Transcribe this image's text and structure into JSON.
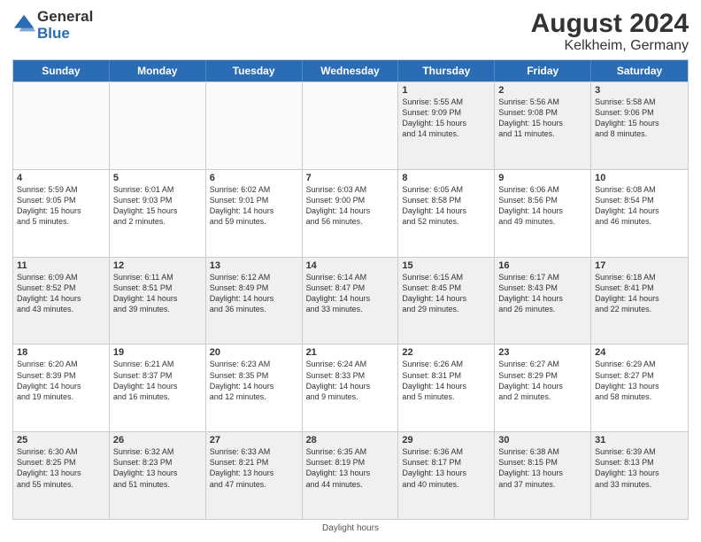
{
  "header": {
    "logo_general": "General",
    "logo_blue": "Blue",
    "main_title": "August 2024",
    "subtitle": "Kelkheim, Germany"
  },
  "days_of_week": [
    "Sunday",
    "Monday",
    "Tuesday",
    "Wednesday",
    "Thursday",
    "Friday",
    "Saturday"
  ],
  "footer": "Daylight hours",
  "weeks": [
    [
      {
        "day": "",
        "info": ""
      },
      {
        "day": "",
        "info": ""
      },
      {
        "day": "",
        "info": ""
      },
      {
        "day": "",
        "info": ""
      },
      {
        "day": "1",
        "info": "Sunrise: 5:55 AM\nSunset: 9:09 PM\nDaylight: 15 hours\nand 14 minutes."
      },
      {
        "day": "2",
        "info": "Sunrise: 5:56 AM\nSunset: 9:08 PM\nDaylight: 15 hours\nand 11 minutes."
      },
      {
        "day": "3",
        "info": "Sunrise: 5:58 AM\nSunset: 9:06 PM\nDaylight: 15 hours\nand 8 minutes."
      }
    ],
    [
      {
        "day": "4",
        "info": "Sunrise: 5:59 AM\nSunset: 9:05 PM\nDaylight: 15 hours\nand 5 minutes."
      },
      {
        "day": "5",
        "info": "Sunrise: 6:01 AM\nSunset: 9:03 PM\nDaylight: 15 hours\nand 2 minutes."
      },
      {
        "day": "6",
        "info": "Sunrise: 6:02 AM\nSunset: 9:01 PM\nDaylight: 14 hours\nand 59 minutes."
      },
      {
        "day": "7",
        "info": "Sunrise: 6:03 AM\nSunset: 9:00 PM\nDaylight: 14 hours\nand 56 minutes."
      },
      {
        "day": "8",
        "info": "Sunrise: 6:05 AM\nSunset: 8:58 PM\nDaylight: 14 hours\nand 52 minutes."
      },
      {
        "day": "9",
        "info": "Sunrise: 6:06 AM\nSunset: 8:56 PM\nDaylight: 14 hours\nand 49 minutes."
      },
      {
        "day": "10",
        "info": "Sunrise: 6:08 AM\nSunset: 8:54 PM\nDaylight: 14 hours\nand 46 minutes."
      }
    ],
    [
      {
        "day": "11",
        "info": "Sunrise: 6:09 AM\nSunset: 8:52 PM\nDaylight: 14 hours\nand 43 minutes."
      },
      {
        "day": "12",
        "info": "Sunrise: 6:11 AM\nSunset: 8:51 PM\nDaylight: 14 hours\nand 39 minutes."
      },
      {
        "day": "13",
        "info": "Sunrise: 6:12 AM\nSunset: 8:49 PM\nDaylight: 14 hours\nand 36 minutes."
      },
      {
        "day": "14",
        "info": "Sunrise: 6:14 AM\nSunset: 8:47 PM\nDaylight: 14 hours\nand 33 minutes."
      },
      {
        "day": "15",
        "info": "Sunrise: 6:15 AM\nSunset: 8:45 PM\nDaylight: 14 hours\nand 29 minutes."
      },
      {
        "day": "16",
        "info": "Sunrise: 6:17 AM\nSunset: 8:43 PM\nDaylight: 14 hours\nand 26 minutes."
      },
      {
        "day": "17",
        "info": "Sunrise: 6:18 AM\nSunset: 8:41 PM\nDaylight: 14 hours\nand 22 minutes."
      }
    ],
    [
      {
        "day": "18",
        "info": "Sunrise: 6:20 AM\nSunset: 8:39 PM\nDaylight: 14 hours\nand 19 minutes."
      },
      {
        "day": "19",
        "info": "Sunrise: 6:21 AM\nSunset: 8:37 PM\nDaylight: 14 hours\nand 16 minutes."
      },
      {
        "day": "20",
        "info": "Sunrise: 6:23 AM\nSunset: 8:35 PM\nDaylight: 14 hours\nand 12 minutes."
      },
      {
        "day": "21",
        "info": "Sunrise: 6:24 AM\nSunset: 8:33 PM\nDaylight: 14 hours\nand 9 minutes."
      },
      {
        "day": "22",
        "info": "Sunrise: 6:26 AM\nSunset: 8:31 PM\nDaylight: 14 hours\nand 5 minutes."
      },
      {
        "day": "23",
        "info": "Sunrise: 6:27 AM\nSunset: 8:29 PM\nDaylight: 14 hours\nand 2 minutes."
      },
      {
        "day": "24",
        "info": "Sunrise: 6:29 AM\nSunset: 8:27 PM\nDaylight: 13 hours\nand 58 minutes."
      }
    ],
    [
      {
        "day": "25",
        "info": "Sunrise: 6:30 AM\nSunset: 8:25 PM\nDaylight: 13 hours\nand 55 minutes."
      },
      {
        "day": "26",
        "info": "Sunrise: 6:32 AM\nSunset: 8:23 PM\nDaylight: 13 hours\nand 51 minutes."
      },
      {
        "day": "27",
        "info": "Sunrise: 6:33 AM\nSunset: 8:21 PM\nDaylight: 13 hours\nand 47 minutes."
      },
      {
        "day": "28",
        "info": "Sunrise: 6:35 AM\nSunset: 8:19 PM\nDaylight: 13 hours\nand 44 minutes."
      },
      {
        "day": "29",
        "info": "Sunrise: 6:36 AM\nSunset: 8:17 PM\nDaylight: 13 hours\nand 40 minutes."
      },
      {
        "day": "30",
        "info": "Sunrise: 6:38 AM\nSunset: 8:15 PM\nDaylight: 13 hours\nand 37 minutes."
      },
      {
        "day": "31",
        "info": "Sunrise: 6:39 AM\nSunset: 8:13 PM\nDaylight: 13 hours\nand 33 minutes."
      }
    ]
  ]
}
